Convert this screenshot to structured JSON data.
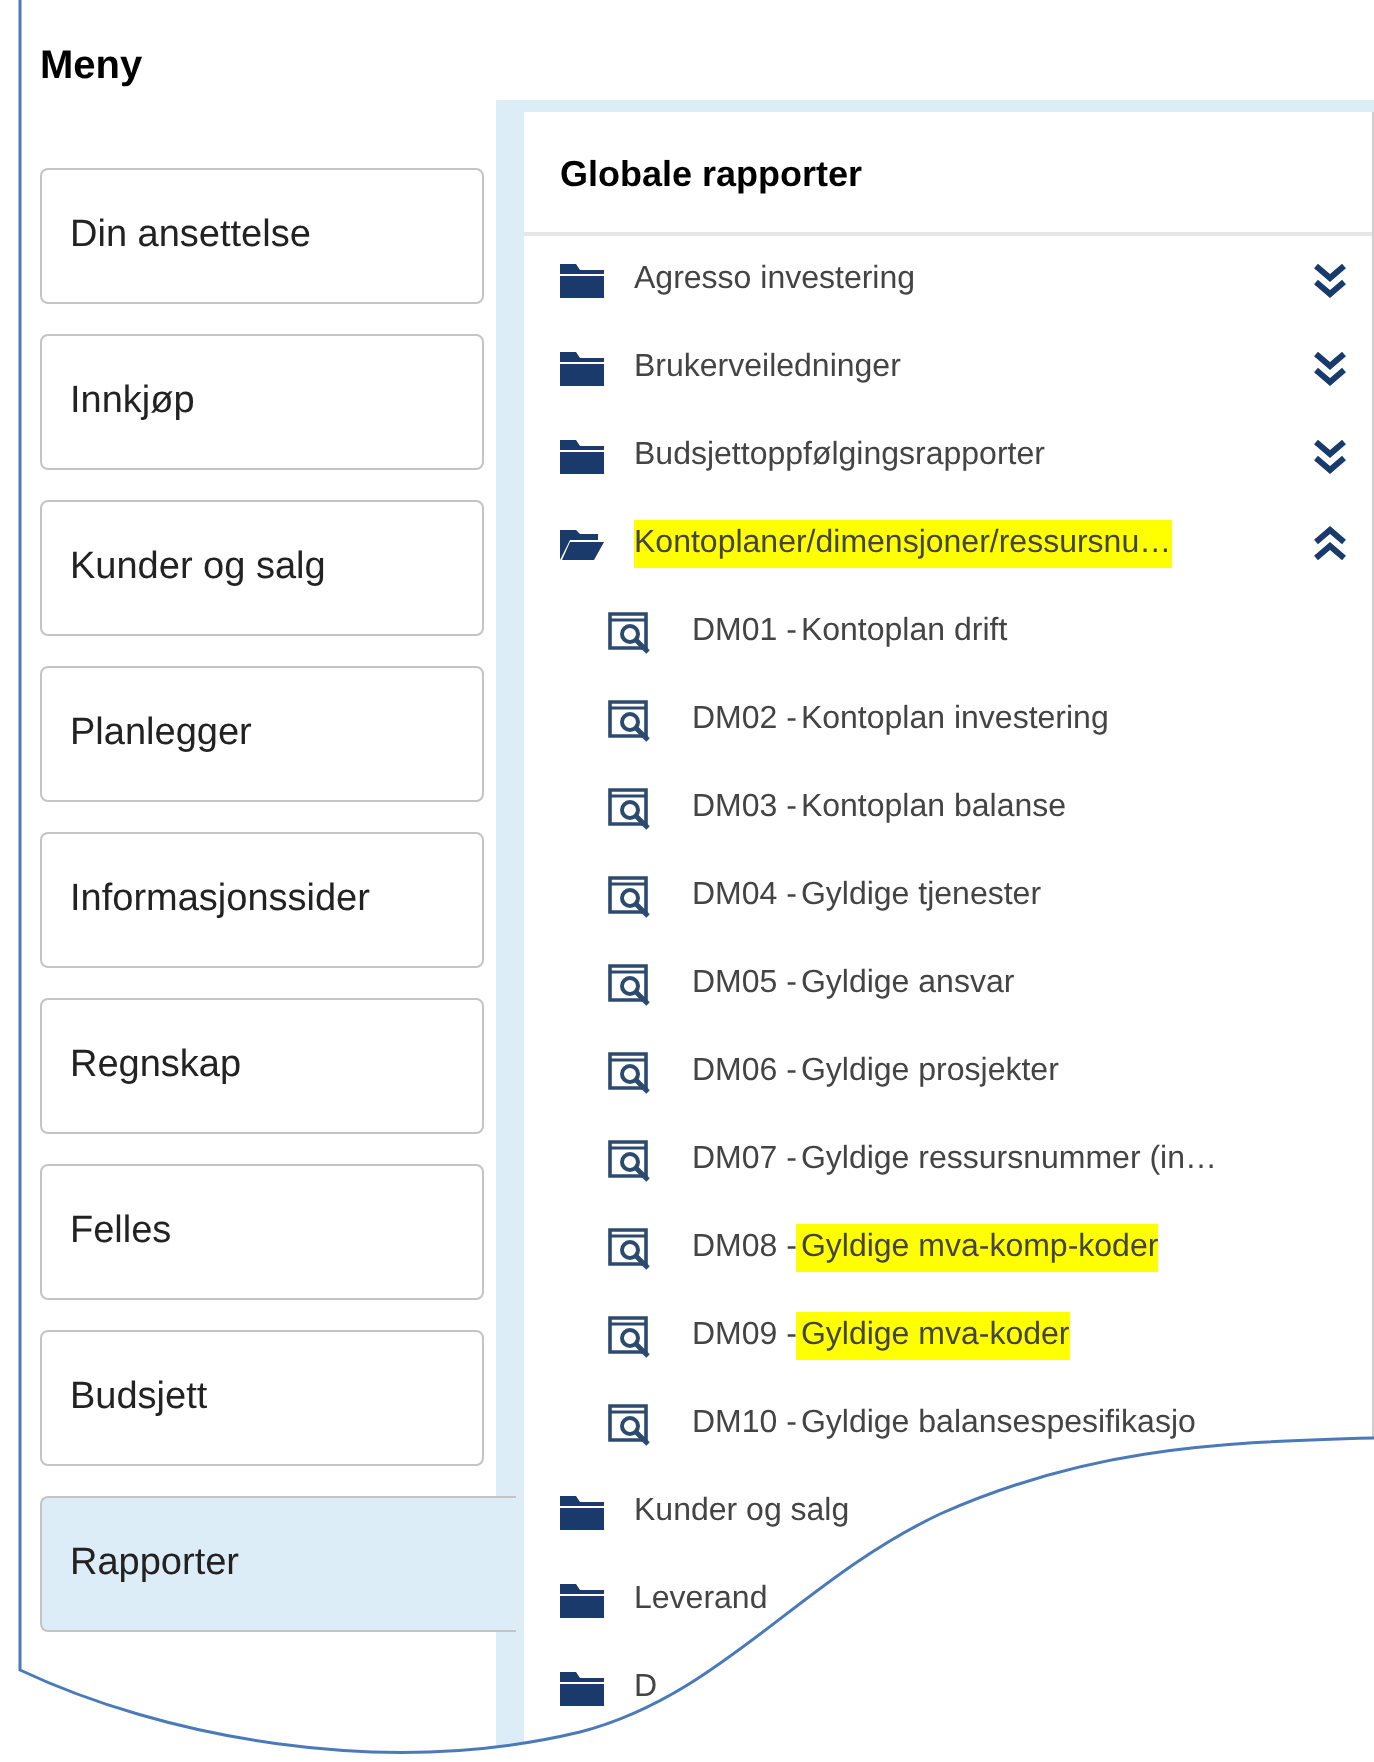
{
  "menu": {
    "title": "Meny",
    "items": [
      {
        "label": "Din ansettelse",
        "selected": false
      },
      {
        "label": "Innkjøp",
        "selected": false
      },
      {
        "label": "Kunder og salg",
        "selected": false
      },
      {
        "label": "Planlegger",
        "selected": false
      },
      {
        "label": "Informasjonssider",
        "selected": false
      },
      {
        "label": "Regnskap",
        "selected": false
      },
      {
        "label": "Felles",
        "selected": false
      },
      {
        "label": "Budsjett",
        "selected": false
      },
      {
        "label": "Rapporter",
        "selected": true
      }
    ]
  },
  "reports": {
    "title": "Globale rapporter",
    "folders": [
      {
        "name": "Agresso investering",
        "expanded": false,
        "highlighted": false
      },
      {
        "name": "Brukerveiledninger",
        "expanded": false,
        "highlighted": false
      },
      {
        "name": "Budsjettoppfølgingsrapporter",
        "expanded": false,
        "highlighted": false
      },
      {
        "name": "Kontoplaner/dimensjoner/ressursnu…",
        "expanded": true,
        "highlighted": true,
        "children": [
          {
            "prefix": "DM01 - ",
            "name": "Kontoplan drift",
            "highlighted": false
          },
          {
            "prefix": "DM02 - ",
            "name": "Kontoplan investering",
            "highlighted": false
          },
          {
            "prefix": "DM03 - ",
            "name": "Kontoplan balanse",
            "highlighted": false
          },
          {
            "prefix": "DM04 - ",
            "name": "Gyldige tjenester",
            "highlighted": false
          },
          {
            "prefix": "DM05 - ",
            "name": "Gyldige ansvar",
            "highlighted": false
          },
          {
            "prefix": "DM06 - ",
            "name": "Gyldige prosjekter",
            "highlighted": false
          },
          {
            "prefix": "DM07 - ",
            "name": "Gyldige ressursnummer (in…",
            "highlighted": false
          },
          {
            "prefix": "DM08 - ",
            "name": "Gyldige mva-komp-koder",
            "highlighted": true
          },
          {
            "prefix": "DM09 - ",
            "name": "Gyldige mva-koder",
            "highlighted": true
          },
          {
            "prefix": "DM10 - ",
            "name": "Gyldige balansespesifikasjo",
            "highlighted": false
          }
        ]
      },
      {
        "name": "Kunder og salg",
        "highlighted": false
      },
      {
        "name": "Leverand",
        "highlighted": false
      },
      {
        "name": "D",
        "highlighted": false
      }
    ]
  }
}
